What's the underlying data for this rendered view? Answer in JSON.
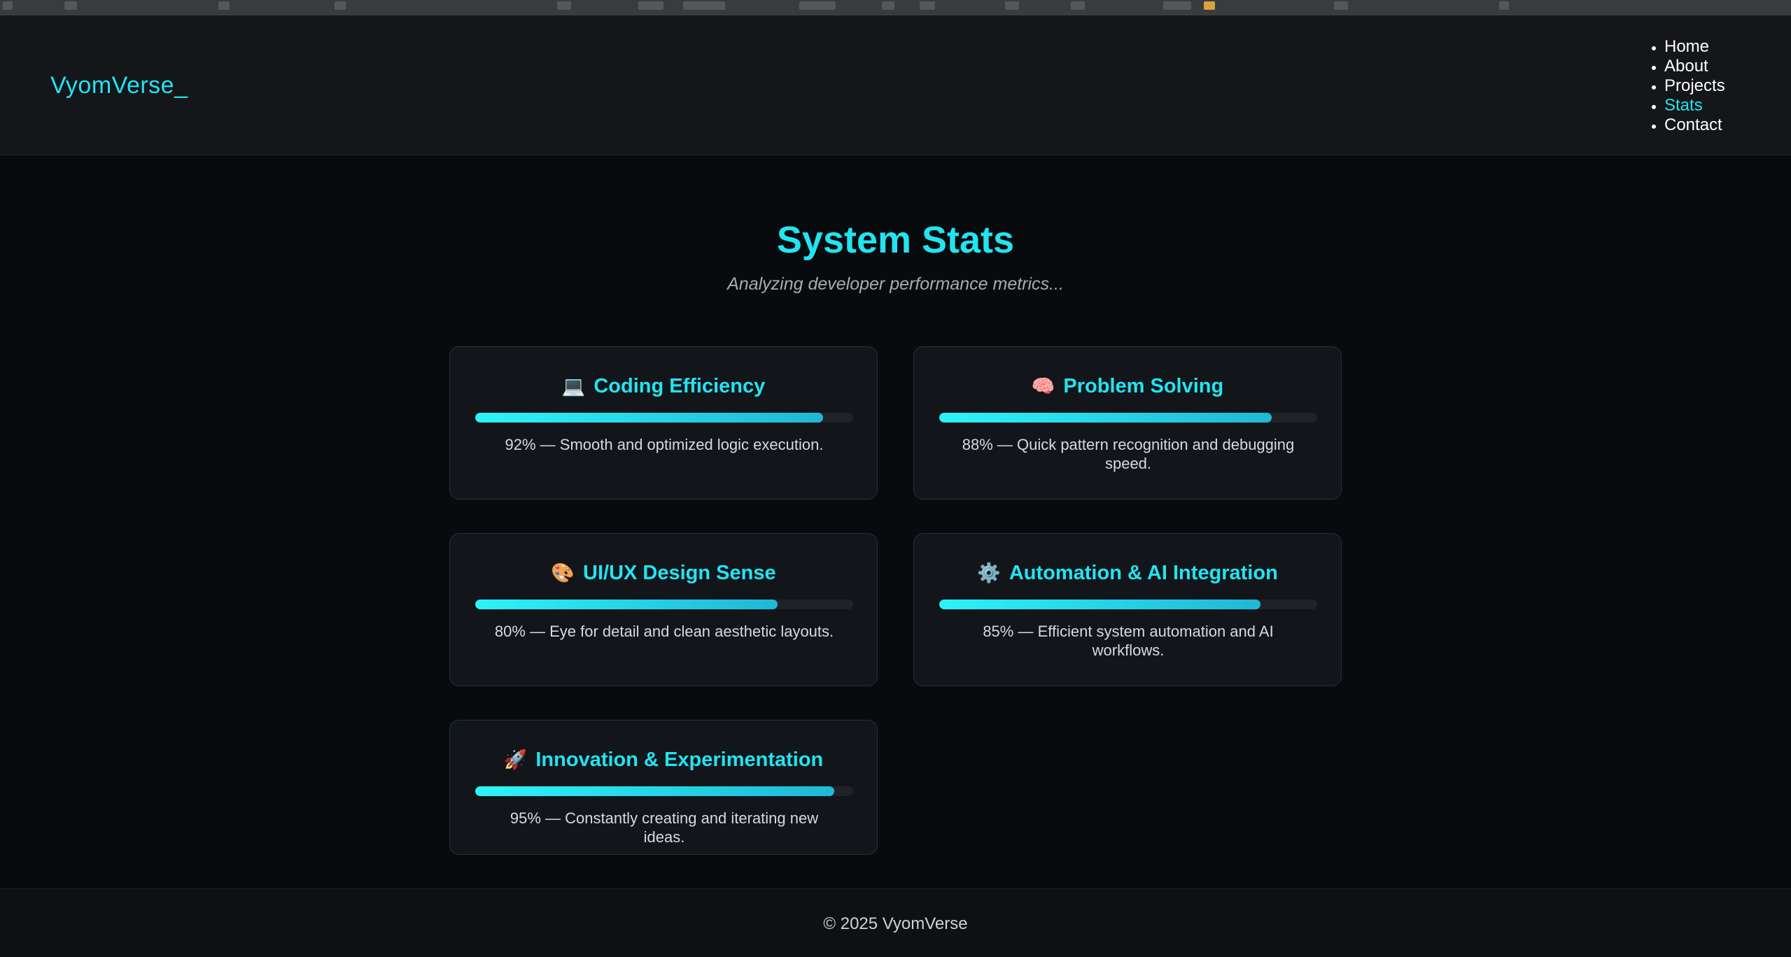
{
  "brand": {
    "logo_text": "VyomVerse_"
  },
  "nav": {
    "items": [
      {
        "label": "Home",
        "active": false
      },
      {
        "label": "About",
        "active": false
      },
      {
        "label": "Projects",
        "active": false
      },
      {
        "label": "Stats",
        "active": true
      },
      {
        "label": "Contact",
        "active": false
      }
    ]
  },
  "hero": {
    "title": "System Stats",
    "subtitle": "Analyzing developer performance metrics..."
  },
  "stats": [
    {
      "icon": "laptop-icon",
      "emoji": "💻",
      "title": "Coding Efficiency",
      "percent": 92,
      "description": "92% — Smooth and optimized logic execution."
    },
    {
      "icon": "brain-icon",
      "emoji": "🧠",
      "title": "Problem Solving",
      "percent": 88,
      "description": "88% — Quick pattern recognition and debugging speed."
    },
    {
      "icon": "palette-icon",
      "emoji": "🎨",
      "title": "UI/UX Design Sense",
      "percent": 80,
      "description": "80% — Eye for detail and clean aesthetic layouts."
    },
    {
      "icon": "gear-icon",
      "emoji": "⚙️",
      "title": "Automation & AI Integration",
      "percent": 85,
      "description": "85% — Efficient system automation and AI workflows."
    },
    {
      "icon": "rocket-icon",
      "emoji": "🚀",
      "title": "Innovation & Experimentation",
      "percent": 95,
      "description": "95% — Constantly creating and iterating new ideas."
    }
  ],
  "footer": {
    "copyright": "© 2025 VyomVerse"
  },
  "colors": {
    "accent": "#22e4f0",
    "background": "#080b0e",
    "card": "#12161b",
    "header": "#141619"
  }
}
